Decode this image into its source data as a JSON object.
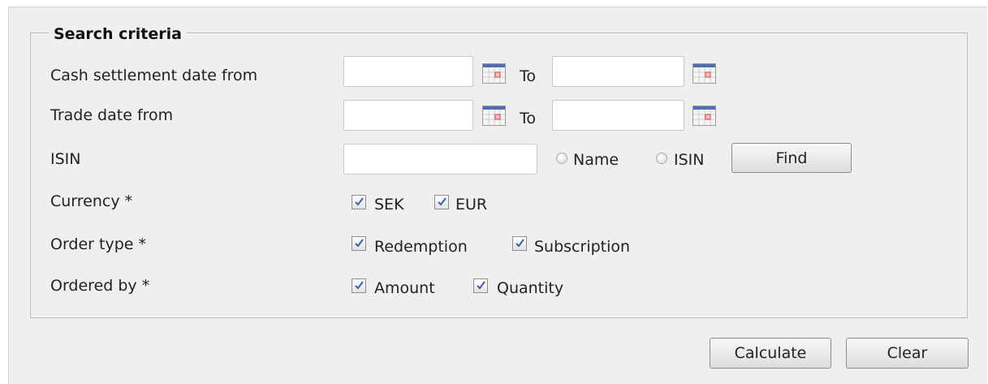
{
  "search": {
    "legend": "Search criteria",
    "cash_settlement": {
      "label": "Cash settlement date from",
      "from_value": "",
      "to_label": "To",
      "to_value": ""
    },
    "trade_date": {
      "label": "Trade date from",
      "from_value": "",
      "to_label": "To",
      "to_value": ""
    },
    "isin": {
      "label": "ISIN",
      "value": "",
      "radio_name_label": "Name",
      "radio_isin_label": "ISIN",
      "find_label": "Find"
    },
    "currency": {
      "label": "Currency *",
      "options": [
        {
          "label": "SEK",
          "checked": true
        },
        {
          "label": "EUR",
          "checked": true
        }
      ]
    },
    "order_type": {
      "label": "Order type *",
      "options": [
        {
          "label": "Redemption",
          "checked": true
        },
        {
          "label": "Subscription",
          "checked": true
        }
      ]
    },
    "ordered_by": {
      "label": "Ordered by *",
      "options": [
        {
          "label": "Amount",
          "checked": true
        },
        {
          "label": "Quantity",
          "checked": true
        }
      ]
    }
  },
  "actions": {
    "calculate_label": "Calculate",
    "clear_label": "Clear"
  },
  "icons": {
    "calendar": "calendar-icon",
    "checkmark": "checkmark-icon"
  },
  "colors": {
    "panel_bg": "#efefef",
    "check_color": "#3a5fb4"
  }
}
